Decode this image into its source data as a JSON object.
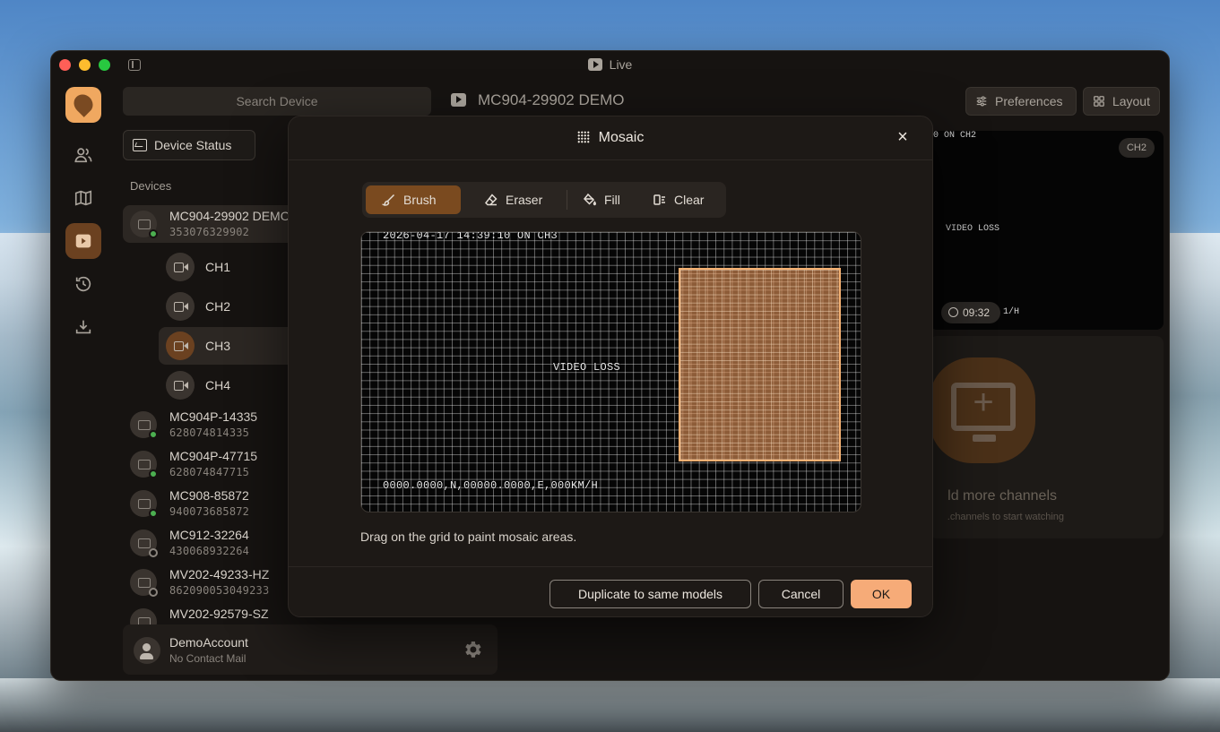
{
  "window": {
    "title": "Live"
  },
  "search": {
    "placeholder": "Search Device"
  },
  "panel": {
    "status_button": "Device Status",
    "devices_label": "Devices",
    "devices": [
      {
        "name": "MC904-29902 DEMO",
        "serial": "353076329902",
        "online": true
      },
      {
        "name": "MC904P-14335",
        "serial": "628074814335",
        "online": true
      },
      {
        "name": "MC904P-47715",
        "serial": "628074847715",
        "online": true
      },
      {
        "name": "MC908-85872",
        "serial": "940073685872",
        "online": true
      },
      {
        "name": "MC912-32264",
        "serial": "430068932264",
        "online": false
      },
      {
        "name": "MV202-49233-HZ",
        "serial": "862090053049233",
        "online": false
      },
      {
        "name": "MV202-92579-SZ",
        "serial": "",
        "online": false
      }
    ],
    "channels": [
      "CH1",
      "CH2",
      "CH3",
      "CH4"
    ],
    "active_channel": "CH3"
  },
  "account": {
    "name": "DemoAccount",
    "mail": "No Contact Mail"
  },
  "main": {
    "title": "MC904-29902 DEMO",
    "preferences_label": "Preferences",
    "layout_label": "Layout",
    "tile1": {
      "osd_top": "0 ON  CH2",
      "osd_mid": "VIDEO LOSS",
      "osd_bottom": "1/H",
      "badge": "CH2",
      "timer": "09:32"
    },
    "tile2": {
      "title": "ld more channels",
      "subtitle": "channels to start watching."
    }
  },
  "modal": {
    "title": "Mosaic",
    "close": "×",
    "tools": {
      "brush": "Brush",
      "eraser": "Eraser",
      "fill": "Fill",
      "clear": "Clear"
    },
    "active_tool": "brush",
    "osd": {
      "timestamp": "2026-04-17 14:39:10 ON  CH3",
      "status": "VIDEO LOSS",
      "gps": "0000.0000,N,00000.0000,E,000KM/H"
    },
    "hint": "Drag on the grid to paint mosaic areas.",
    "buttons": {
      "duplicate": "Duplicate to same models",
      "cancel": "Cancel",
      "ok": "OK"
    }
  },
  "colors": {
    "accent": "#f6ab78",
    "brush_active": "#7a4a1f",
    "paint_fill": "#e8965a",
    "online": "#4caf50"
  },
  "icons": [
    "users-icon",
    "map-icon",
    "live-icon",
    "history-icon",
    "download-icon",
    "gear-icon",
    "sliders-icon",
    "grid-icon",
    "brush-icon",
    "eraser-icon",
    "fill-icon",
    "clear-icon",
    "mosaic-icon"
  ]
}
